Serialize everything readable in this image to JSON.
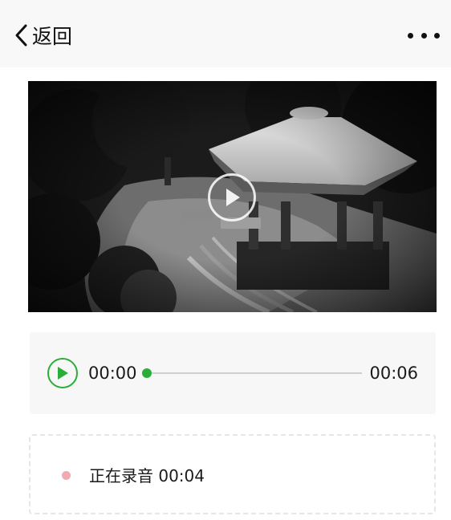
{
  "nav": {
    "back_label": "返回",
    "back_icon": "chevron-left-icon",
    "more_icon": "more-dots-icon"
  },
  "video": {
    "thumbnail": "snowy-pavilion-garden",
    "play_icon": "play-circle-icon"
  },
  "audio": {
    "current_time": "00:00",
    "total_time": "00:06",
    "progress": 0,
    "play_icon": "play-icon",
    "accent_color": "#2aae38"
  },
  "recording": {
    "status_text": "正在录音 00:04",
    "indicator_color": "#f2aab0"
  }
}
